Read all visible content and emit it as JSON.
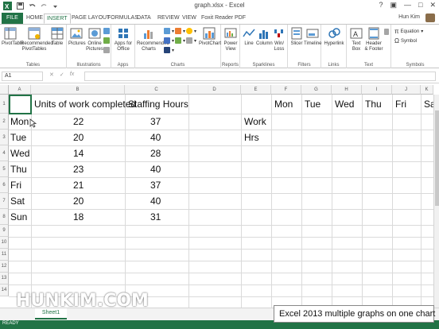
{
  "window": {
    "title": "graph.xlsx - Excel",
    "help": "?",
    "minimize": "—",
    "maximize": "□",
    "close": "✕"
  },
  "ribbon_tabs": [
    "FILE",
    "HOME",
    "INSERT",
    "PAGE LAYOUT",
    "FORMULAS",
    "DATA",
    "REVIEW",
    "VIEW",
    "Foxit Reader PDF"
  ],
  "user_name": "Hun Kim",
  "ribbon_groups": {
    "tables": {
      "label": "Tables",
      "cmds": [
        "PivotTable",
        "Recommended PivotTables",
        "Table"
      ]
    },
    "illustrations": {
      "label": "Illustrations",
      "cmds": [
        "Pictures",
        "Online Pictures"
      ]
    },
    "apps": {
      "label": "Apps",
      "cmds": [
        "Apps for Office"
      ]
    },
    "charts": {
      "label": "Charts",
      "cmds": [
        "Recommended Charts",
        "PivotChart"
      ]
    },
    "reports": {
      "label": "Reports",
      "cmds": [
        "Power View"
      ]
    },
    "sparklines": {
      "label": "Sparklines",
      "cmds": [
        "Line",
        "Column",
        "Win/ Loss"
      ]
    },
    "filters": {
      "label": "Filters",
      "cmds": [
        "Slicer",
        "Timeline"
      ]
    },
    "links": {
      "label": "Links",
      "cmds": [
        "Hyperlink"
      ]
    },
    "text": {
      "label": "Text",
      "cmds": [
        "Text Box",
        "Header & Footer"
      ]
    },
    "symbols": {
      "label": "Symbols",
      "cmds": [
        "Equation",
        "Symbol"
      ]
    }
  },
  "formula_bar": {
    "name_box": "A1",
    "cancel": "✕",
    "enter": "✓",
    "fx": "fx",
    "formula": ""
  },
  "columns": [
    "A",
    "B",
    "C",
    "D",
    "E",
    "F",
    "G",
    "H",
    "I",
    "J",
    "K"
  ],
  "rows": [
    "1",
    "2",
    "3",
    "4",
    "5",
    "6",
    "7",
    "8",
    "9",
    "10",
    "11",
    "12",
    "13",
    "14"
  ],
  "sheet": {
    "headers": [
      "Units of work completed",
      "Staffing Hours"
    ],
    "data": [
      {
        "day": "Mon",
        "units": "22",
        "hours": "37"
      },
      {
        "day": "Tue",
        "units": "20",
        "hours": "40"
      },
      {
        "day": "Wed",
        "units": "14",
        "hours": "28"
      },
      {
        "day": "Thu",
        "units": "23",
        "hours": "40"
      },
      {
        "day": "Fri",
        "units": "21",
        "hours": "37"
      },
      {
        "day": "Sat",
        "units": "20",
        "hours": "40"
      },
      {
        "day": "Sun",
        "units": "18",
        "hours": "31"
      }
    ],
    "side_labels": [
      "Work",
      "Hrs"
    ],
    "top_days": [
      "Mon",
      "Tue",
      "Wed",
      "Thu",
      "Fri",
      "Sa"
    ]
  },
  "sheet_tab": "Sheet1",
  "status": "READY",
  "watermark": "HUNKIM.COM",
  "caption": "Excel 2013 multiple graphs on one chart"
}
